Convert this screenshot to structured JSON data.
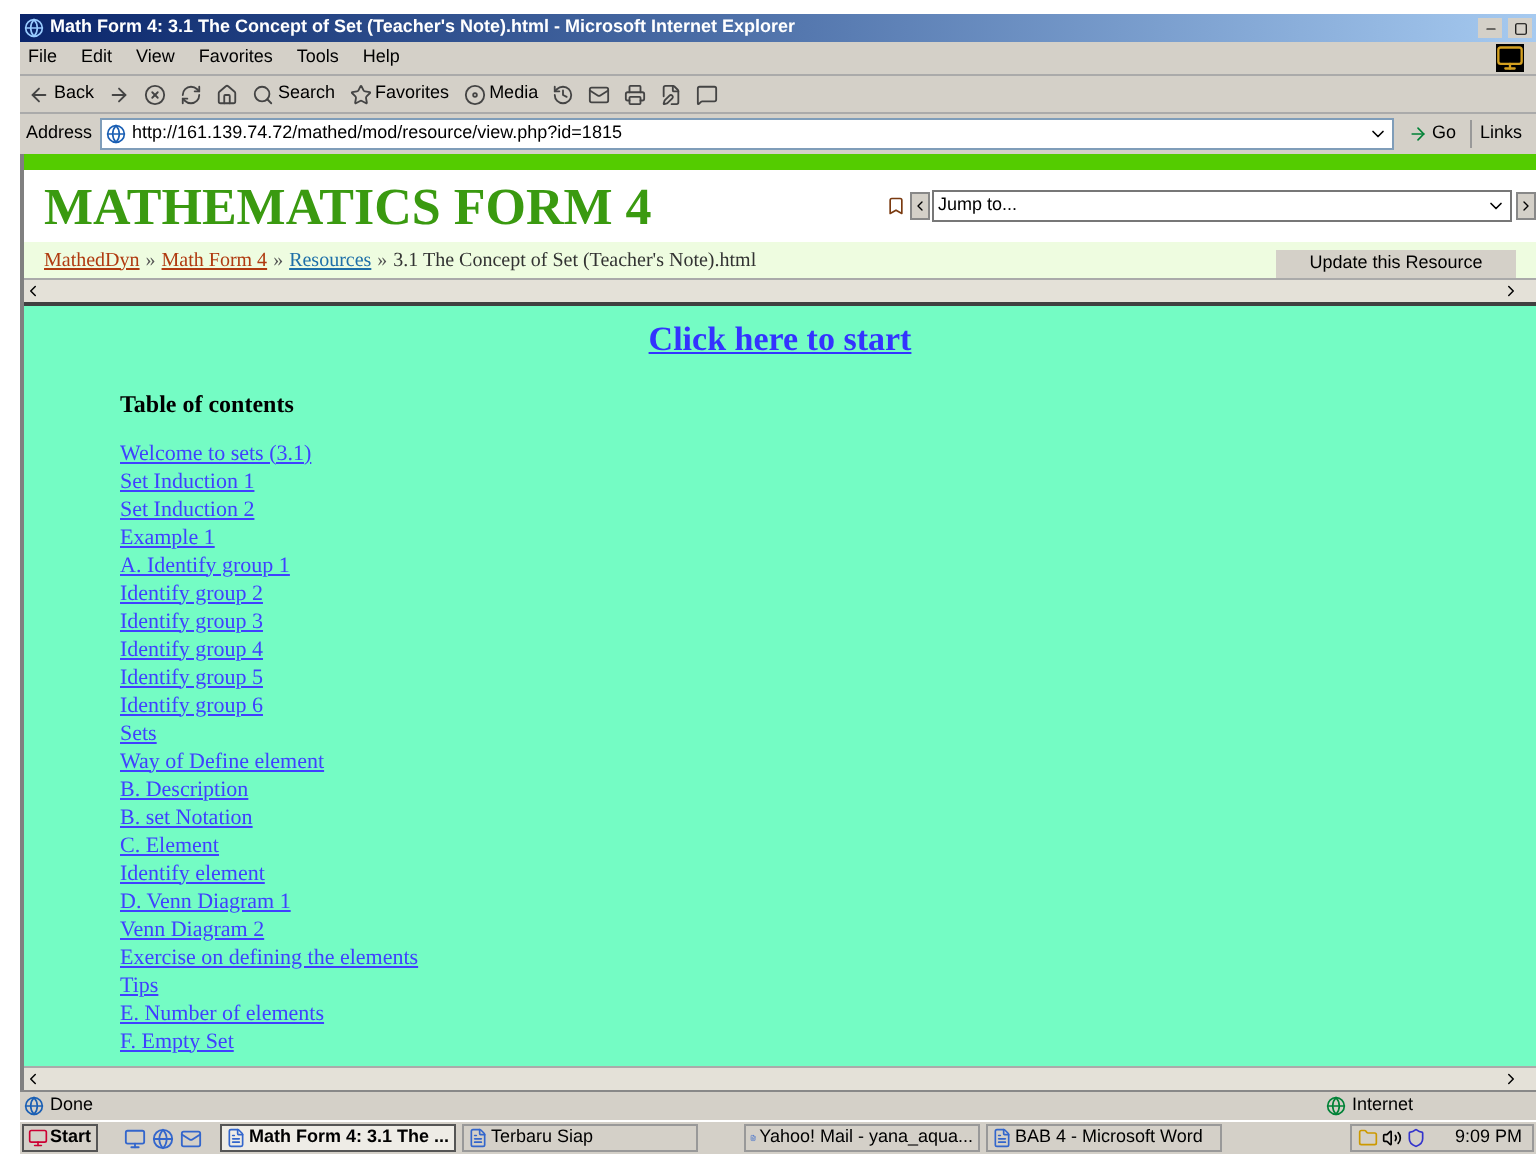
{
  "window": {
    "title": "Math Form 4: 3.1 The Concept of Set (Teacher's Note).html - Microsoft Internet Explorer"
  },
  "menu": [
    "File",
    "Edit",
    "View",
    "Favorites",
    "Tools",
    "Help"
  ],
  "toolbar": [
    {
      "kind": "back",
      "label": "Back"
    },
    {
      "kind": "forward"
    },
    {
      "kind": "stop"
    },
    {
      "kind": "refresh"
    },
    {
      "kind": "home"
    },
    {
      "kind": "search",
      "label": "Search"
    },
    {
      "kind": "favorites",
      "label": "Favorites"
    },
    {
      "kind": "media",
      "label": "Media"
    },
    {
      "kind": "history"
    },
    {
      "kind": "mail"
    },
    {
      "kind": "print"
    },
    {
      "kind": "edit"
    },
    {
      "kind": "discuss"
    }
  ],
  "address": {
    "label": "Address",
    "url": "http://161.139.74.72/mathed/mod/resource/view.php?id=1815",
    "go": "Go",
    "links": "Links"
  },
  "page": {
    "title": "MATHEMATICS FORM 4",
    "jump": {
      "placeholder": "Jump to..."
    },
    "breadcrumb": [
      {
        "kind": "link",
        "label": "MathedDyn"
      },
      {
        "kind": "sep",
        "label": "»"
      },
      {
        "kind": "link",
        "label": "Math Form 4"
      },
      {
        "kind": "sep",
        "label": "»"
      },
      {
        "kind": "visited",
        "label": "Resources"
      },
      {
        "kind": "sep",
        "label": "»"
      },
      {
        "kind": "current",
        "label": "3.1 The Concept of Set (Teacher's Note).html"
      }
    ],
    "update_button": "Update this Resource",
    "start_link": "Click here to start",
    "toc_heading": "Table of contents",
    "toc": [
      "Welcome to sets (3.1)",
      "Set Induction 1",
      "Set Induction 2",
      "Example 1",
      "A. Identify group 1",
      "Identify group 2",
      "Identify group 3",
      "Identify group 4",
      "Identify group 5",
      "Identify group 6",
      "Sets",
      "Way of Define element",
      "B. Description",
      "B. set Notation",
      "C. Element",
      "Identify element",
      "D. Venn Diagram 1",
      "Venn Diagram 2",
      "Exercise on defining the elements",
      "Tips",
      "E. Number of elements",
      "F. Empty Set"
    ]
  },
  "status_bar": {
    "text": "Done",
    "zone": "Internet"
  },
  "taskbar": {
    "start": "Start",
    "tasks": [
      {
        "label": "Math Form 4: 3.1 The ...",
        "selected": true
      },
      {
        "label": "Terbaru Siap",
        "selected": false
      },
      {
        "label": "Yahoo! Mail - yana_aqua...",
        "selected": false
      },
      {
        "label": "BAB 4 - Microsoft Word",
        "selected": false
      }
    ],
    "clock": "9:09 PM"
  }
}
